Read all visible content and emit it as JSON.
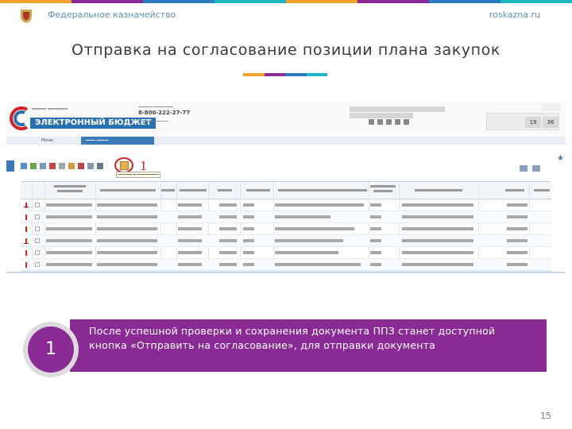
{
  "header": {
    "org": "Федеральное казначейство",
    "site": "roskazna.ru",
    "emblem": "coat-of-arms-emblem"
  },
  "slide": {
    "title": "Отправка на согласование позиции плана закупок",
    "page_number": "15"
  },
  "colors": {
    "accent_orange": "#f0a12a",
    "accent_purple": "#8a2a95",
    "accent_blue": "#2b7bbf",
    "accent_teal": "#1fb7c4",
    "marker_red": "#d62027"
  },
  "screenshot": {
    "phone": "8-800-222-27-77",
    "brand": "ЭЛЕКТРОННЫЙ БЮДЖЕТ",
    "menu": "Меню",
    "date_day": "19",
    "date_min": "36",
    "marker_label": "1"
  },
  "callout": {
    "number": "1",
    "text": "После успешной проверки и сохранения документа ППЗ станет доступной кнопка «Отправить на согласование», для отправки документа"
  }
}
